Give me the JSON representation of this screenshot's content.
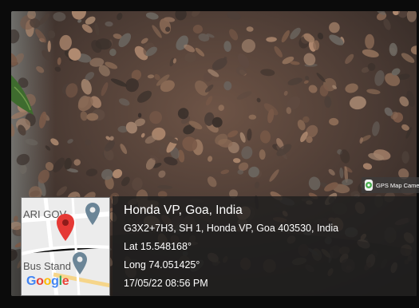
{
  "overlay": {
    "watermark_label": "GPS Map Came",
    "map": {
      "label_top": "ARI GOV",
      "label_bottom": "Bus Stand",
      "logo": "Google",
      "pin_color": "#e53935",
      "marker_icon": "location-marker-icon"
    },
    "address_title": "Honda VP, Goa, India",
    "address_line": "G3X2+7H3, SH 1, Honda VP, Goa 403530, India",
    "latitude": "Lat 15.548168°",
    "longitude": "Long 74.051425°",
    "datetime": "17/05/22 08:56 PM"
  }
}
